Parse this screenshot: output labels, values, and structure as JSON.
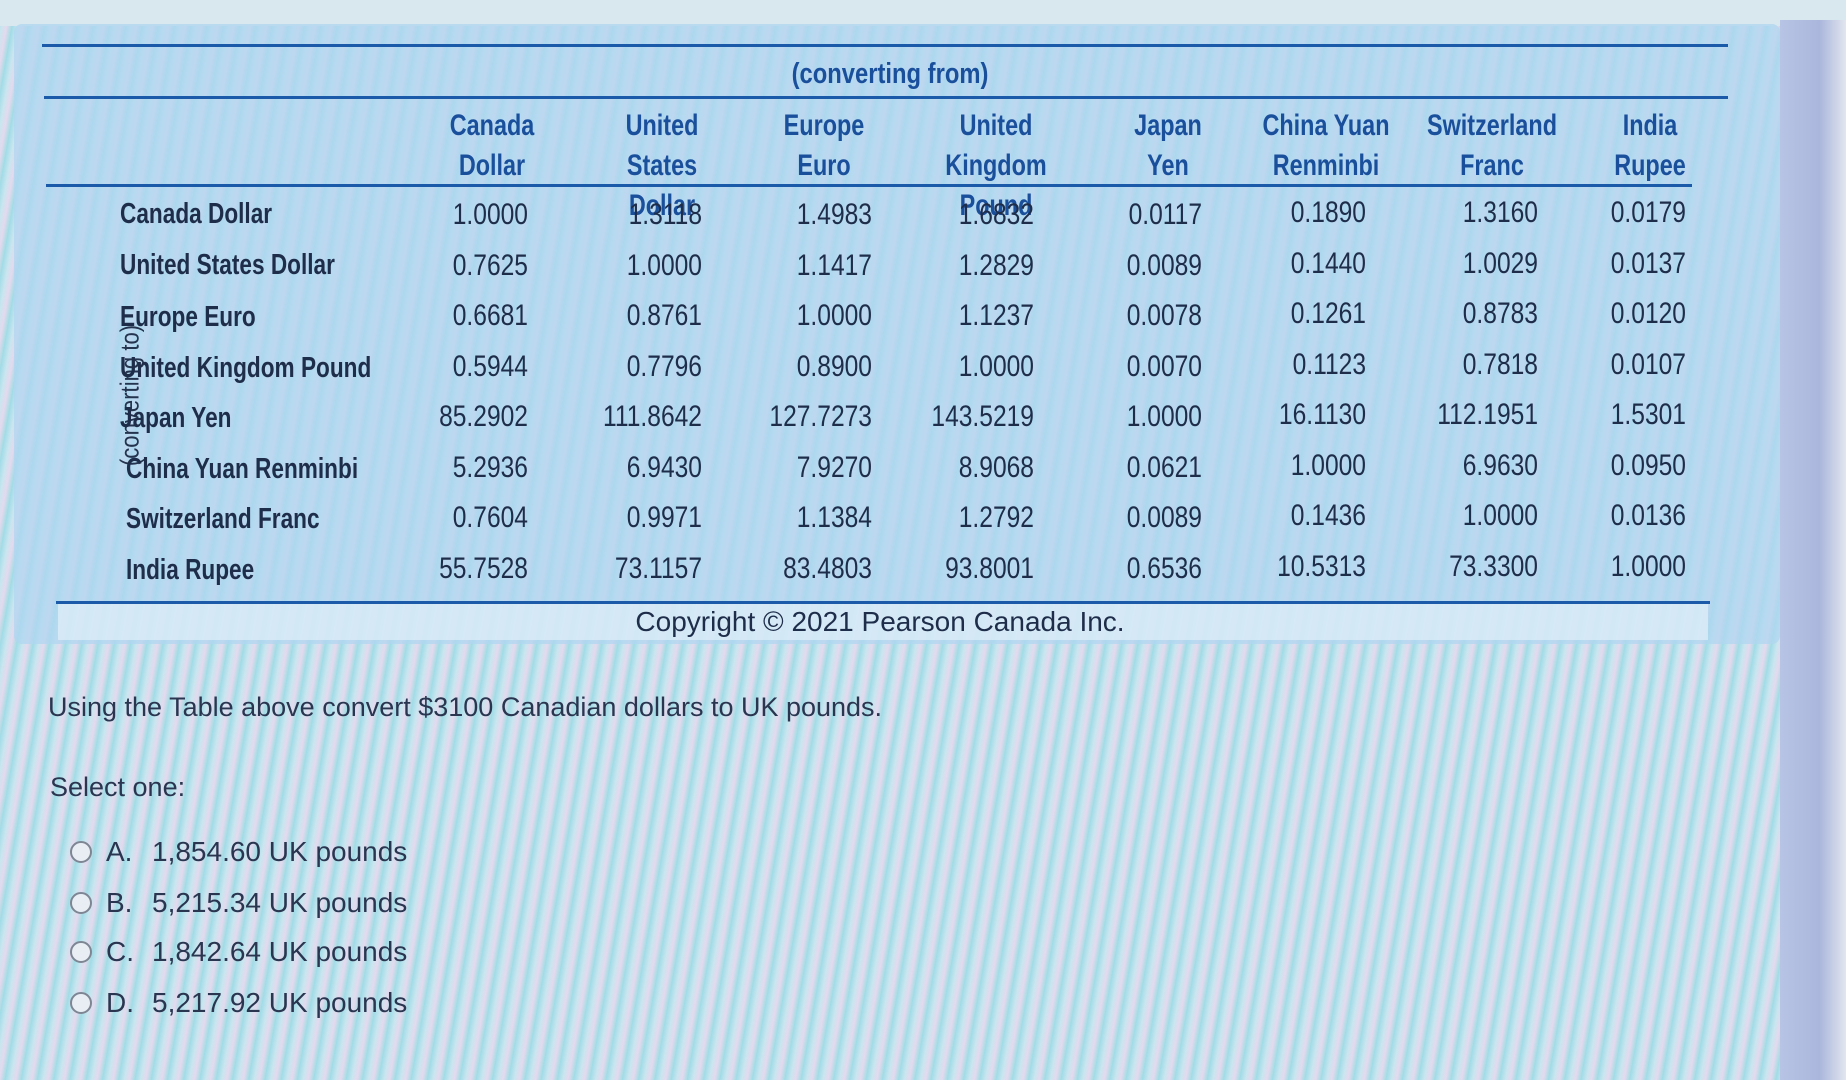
{
  "table": {
    "from_caption": "(converting from)",
    "to_caption": "(converting to)",
    "columns": [
      {
        "line1": "Canada",
        "line2": "Dollar"
      },
      {
        "line1": "United States",
        "line2": "Dollar"
      },
      {
        "line1": "Europe",
        "line2": "Euro"
      },
      {
        "line1": "United Kingdom",
        "line2": "Pound"
      },
      {
        "line1": "Japan",
        "line2": "Yen"
      },
      {
        "line1": "China Yuan",
        "line2": "Renminbi"
      },
      {
        "line1": "Switzerland",
        "line2": "Franc"
      },
      {
        "line1": "India",
        "line2": "Rupee"
      }
    ],
    "rows": [
      {
        "label": "Canada Dollar",
        "values": [
          "1.0000",
          "1.3118",
          "1.4983",
          "1.6832",
          "0.0117",
          "0.1890",
          "1.3160",
          "0.0179"
        ]
      },
      {
        "label": "United States Dollar",
        "values": [
          "0.7625",
          "1.0000",
          "1.1417",
          "1.2829",
          "0.0089",
          "0.1440",
          "1.0029",
          "0.0137"
        ]
      },
      {
        "label": "Europe Euro",
        "values": [
          "0.6681",
          "0.8761",
          "1.0000",
          "1.1237",
          "0.0078",
          "0.1261",
          "0.8783",
          "0.0120"
        ]
      },
      {
        "label": "United Kingdom Pound",
        "values": [
          "0.5944",
          "0.7796",
          "0.8900",
          "1.0000",
          "0.0070",
          "0.1123",
          "0.7818",
          "0.0107"
        ]
      },
      {
        "label": "Japan Yen",
        "values": [
          "85.2902",
          "111.8642",
          "127.7273",
          "143.5219",
          "1.0000",
          "16.1130",
          "112.1951",
          "1.5301"
        ]
      },
      {
        "label": "China Yuan Renminbi",
        "values": [
          "5.2936",
          "6.9430",
          "7.9270",
          "8.9068",
          "0.0621",
          "1.0000",
          "6.9630",
          "0.0950"
        ]
      },
      {
        "label": "Switzerland Franc",
        "values": [
          "0.7604",
          "0.9971",
          "1.1384",
          "1.2792",
          "0.0089",
          "0.1436",
          "1.0000",
          "0.0136"
        ]
      },
      {
        "label": "India Rupee",
        "values": [
          "55.7528",
          "73.1157",
          "83.4803",
          "93.8001",
          "0.6536",
          "10.5313",
          "73.3300",
          "1.0000"
        ]
      }
    ],
    "copyright": "Copyright © 2021 Pearson Canada Inc."
  },
  "question": {
    "text": "Using the Table above convert $3100 Canadian dollars to UK pounds.",
    "prompt": "Select one:",
    "options": [
      {
        "letter": "A.",
        "text": "1,854.60 UK pounds"
      },
      {
        "letter": "B.",
        "text": "5,215.34 UK pounds"
      },
      {
        "letter": "C.",
        "text": "1,842.64 UK pounds"
      },
      {
        "letter": "D.",
        "text": "5,217.92 UK pounds"
      }
    ]
  }
}
